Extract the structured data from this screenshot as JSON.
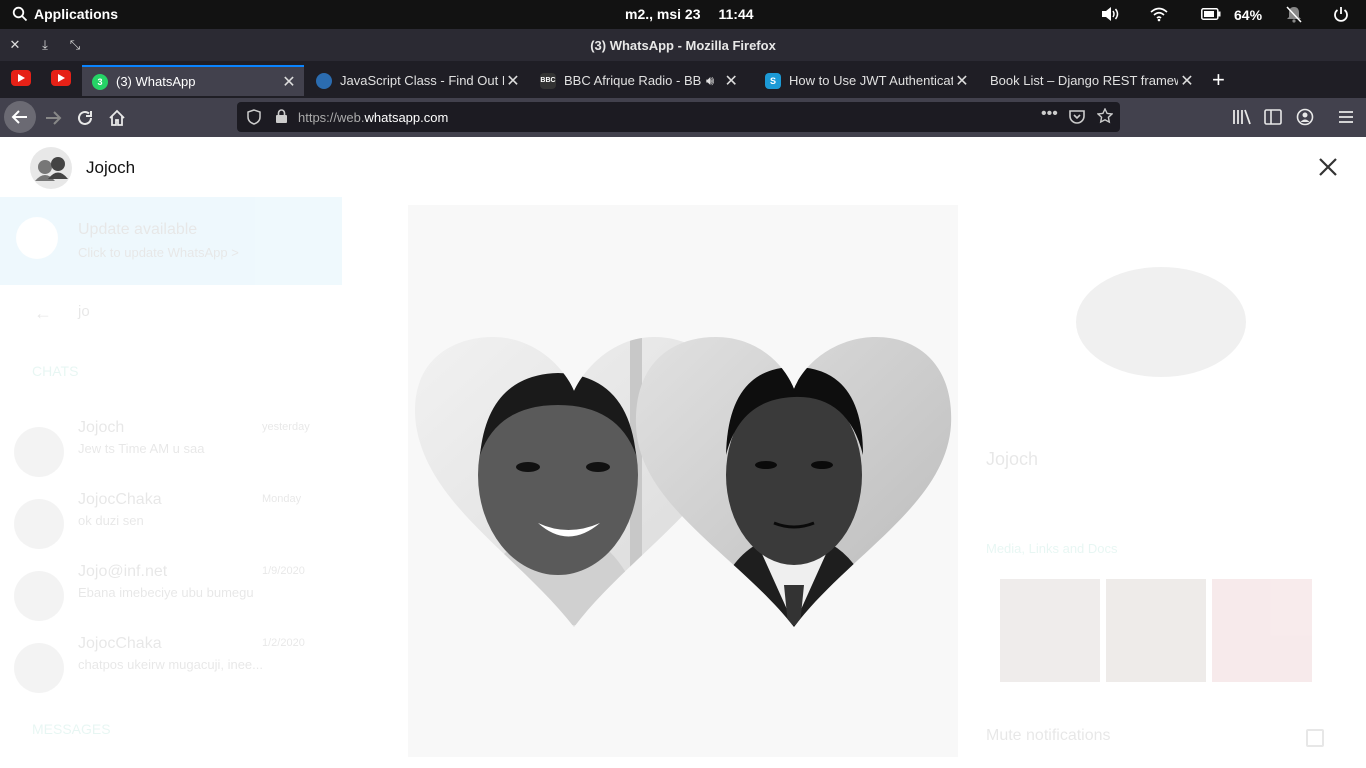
{
  "os": {
    "apps_label": "Applications",
    "date": "m2., msi 23",
    "time": "11:44",
    "battery": "64%"
  },
  "window": {
    "title": "(3) WhatsApp - Mozilla Firefox"
  },
  "tabs": [
    {
      "label": "(3) WhatsApp",
      "active": true
    },
    {
      "label": "JavaScript Class - Find Out How",
      "active": false
    },
    {
      "label": "BBC Afrique Radio - BBC News",
      "active": false
    },
    {
      "label": "How to Use JWT Authentication",
      "active": false
    },
    {
      "label": "Book List – Django REST framework",
      "active": false
    }
  ],
  "nav": {
    "url_prefix": "https://web.",
    "url_domain": "whatsapp.com"
  },
  "viewer": {
    "contact_name": "Jojoch"
  },
  "background": {
    "update_title": "Update available",
    "update_sub": "Click to update WhatsApp >",
    "search_value": "jo",
    "chats_header": "CHATS",
    "messages_header": "MESSAGES",
    "chats": [
      {
        "name": "Jojoch",
        "time": "yesterday",
        "msg": "Jew ts Time AM u saa"
      },
      {
        "name": "JojocChaka",
        "time": "Monday",
        "msg": "ok duzi sen"
      },
      {
        "name": "Jojo@inf.net",
        "time": "1/9/2020",
        "msg": "Ebana imebeciye ubu bumegu"
      },
      {
        "name": "JojocChaka",
        "time": "1/2/2020",
        "msg": "chatpos ukeirw mugacuji, inee..."
      }
    ],
    "profile_name": "Jojoch",
    "media_label": "Media, Links and Docs",
    "mute_label": "Mute notifications"
  },
  "colors": {
    "os_bar": "#121212",
    "tab_accent": "#0a84ff",
    "whatsapp_green": "#25d366",
    "update_banner": "#53bdeb"
  }
}
